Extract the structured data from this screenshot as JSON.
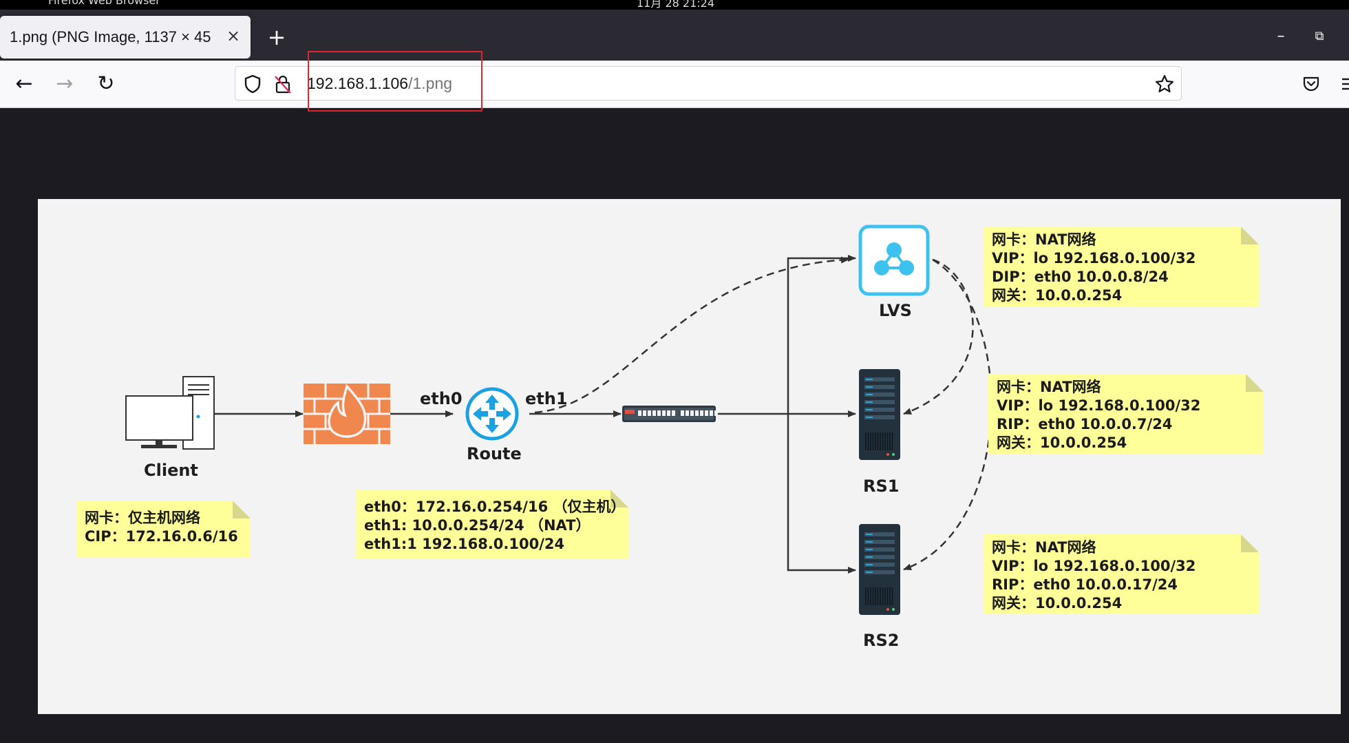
{
  "system_bar": {
    "app_title": "Firefox Web Browser",
    "clock": "11月 28 21:24"
  },
  "browser": {
    "tab": {
      "title": "1.png (PNG Image, 1137 × 45",
      "close": "×"
    },
    "new_tab": "+",
    "window_controls": {
      "minimize": "–",
      "restore": "⧉"
    },
    "nav": {
      "back": "←",
      "forward": "→",
      "reload": "↻"
    },
    "url": {
      "host": "192.168.1.106",
      "path": "/1.png"
    },
    "icons": [
      "shield-icon",
      "insecure-lock-icon",
      "bookmark-star-icon",
      "pocket-icon",
      "menu-icon"
    ]
  },
  "diagram": {
    "nodes": {
      "client": "Client",
      "route": "Route",
      "lvs": "LVS",
      "rs1": "RS1",
      "rs2": "RS2"
    },
    "interfaces": {
      "eth0": "eth0",
      "eth1": "eth1"
    },
    "notes": {
      "client": [
        "网卡：仅主机网络",
        "CIP：172.16.0.6/16"
      ],
      "route": [
        "eth0：172.16.0.254/16 （仅主机）",
        "eth1: 10.0.0.254/24 （NAT）",
        "eth1:1 192.168.0.100/24"
      ],
      "lvs": [
        "网卡：NAT网络",
        "VIP：lo 192.168.0.100/32",
        "DIP：eth0 10.0.0.8/24",
        "网关：10.0.0.254"
      ],
      "rs1": [
        "网卡：NAT网络",
        "VIP：lo 192.168.0.100/32",
        "RIP：eth0 10.0.0.7/24",
        "网关：10.0.0.254"
      ],
      "rs2": [
        "网卡：NAT网络",
        "VIP：lo 192.168.0.100/32",
        "RIP：eth0 10.0.0.17/24",
        "网关：10.0.0.254"
      ]
    },
    "colors": {
      "firewall": "#f0874f",
      "router": "#1ba1e2",
      "lvs": "#3dc2f0",
      "server": "#23313d",
      "note": "#ffff99"
    }
  }
}
